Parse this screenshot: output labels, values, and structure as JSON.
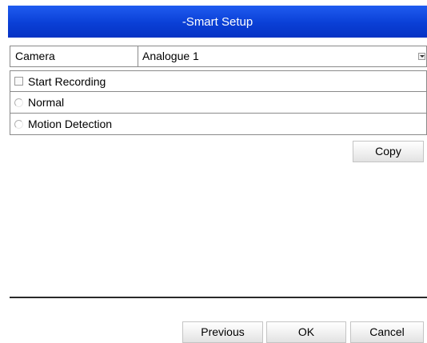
{
  "window": {
    "title": "-Smart Setup"
  },
  "camera": {
    "label": "Camera",
    "selected": "Analogue 1"
  },
  "options": {
    "start_recording": "Start Recording",
    "normal": "Normal",
    "motion_detection": "Motion Detection"
  },
  "buttons": {
    "copy": "Copy",
    "previous": "Previous",
    "ok": "OK",
    "cancel": "Cancel"
  },
  "colors": {
    "titlebar": "#0a3fd6",
    "background": "#ffffff"
  }
}
